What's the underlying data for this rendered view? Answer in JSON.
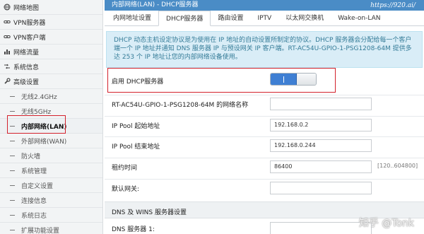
{
  "sidebar": {
    "items": [
      {
        "label": "网络地图",
        "icon": "globe-icon"
      },
      {
        "label": "VPN服务器",
        "icon": "link-icon"
      },
      {
        "label": "VPN客户端",
        "icon": "link-icon"
      },
      {
        "label": "网络流量",
        "icon": "chart-icon"
      },
      {
        "label": "系统信息",
        "icon": "shuffle-icon"
      },
      {
        "label": "高级设置",
        "icon": "wrench-icon"
      }
    ],
    "subitems": [
      "无线2.4GHz",
      "无线5GHz",
      "内部网络(LAN)",
      "外部网络(WAN)",
      "防火墙",
      "系统管理",
      "自定义设置",
      "连接信息",
      "系统日志",
      "扩展功能设置"
    ]
  },
  "main": {
    "title": "内部网络(LAN) - DHCP服务器",
    "watermark_url": "https://920.ai/",
    "tabs": [
      "内网地址设置",
      "DHCP服务器",
      "路由设置",
      "IPTV",
      "以太网交换机",
      "Wake-on-LAN"
    ],
    "info": "DHCP 动态主机设定协议是为使用在 IP 地址的自动设置所制定的协议。DHCP 服务器会分配给每一个客户端一个 IP 地址并通知 DNS 服务器 IP 与预设网关 IP 客户端。RT-AC54U-GPIO-1-PSG1208-64M 提供多达 253 个 IP 地址让您的内部网络设备使用。",
    "form": {
      "enable_dhcp_label": "启用 DHCP服务器",
      "enable_dhcp_value": "I",
      "domain_label": "RT-AC54U-GPIO-1-PSG1208-64M 的网络名称",
      "domain_value": "",
      "ip_start_label": "IP Pool 起始地址",
      "ip_start_value": "192.168.0.2",
      "ip_end_label": "IP Pool 结束地址",
      "ip_end_value": "192.168.0.244",
      "lease_label": "租约时间",
      "lease_value": "86400",
      "lease_hint": "[120..604800]",
      "gateway_label": "默认网关:",
      "gateway_value": ""
    },
    "dns_section_title": "DNS 及 WINS 服务器设置",
    "dns1_label": "DNS 服务器 1:"
  },
  "watermark": "知乎 @Tonk",
  "colors": {
    "accent": "#4a8cc6",
    "highlight_box": "#d3212c",
    "toggle_on": "#3f7fd3"
  }
}
